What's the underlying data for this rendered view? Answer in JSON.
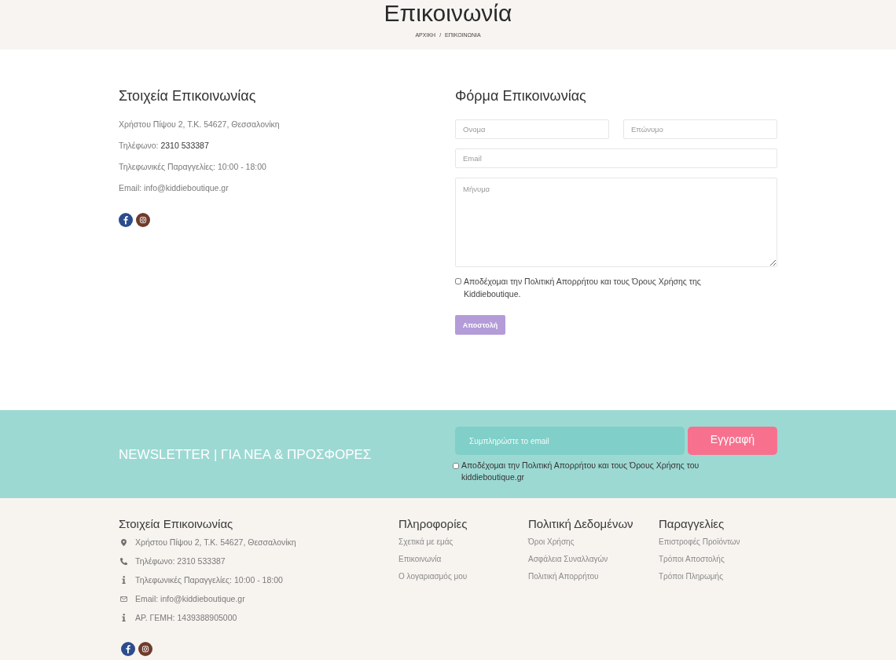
{
  "page_header": {
    "title": "Επικοινωνία",
    "breadcrumb": [
      {
        "label": "ΑΡΧΙΚΗ"
      },
      {
        "label": "ΕΠΙΚΟΙΝΩΝΙΑ"
      }
    ],
    "separator": "/"
  },
  "contact_info": {
    "heading": "Στοιχεία Επικοινωνίας",
    "lines": [
      {
        "text": "Χρήστου Πίψου 2, Τ.Κ. 54627, Θεσσαλονίκη"
      },
      {
        "text": "Τηλέφωνο:",
        "link": "2310 533387"
      },
      {
        "text": "Τηλεφωνικές Παραγγελίες: 10:00 - 18:00"
      },
      {
        "text": "Email: info@kiddieboutique.gr"
      }
    ],
    "socials": [
      {
        "kind": "facebook"
      },
      {
        "kind": "instagram"
      }
    ]
  },
  "contact_form": {
    "heading": "Φόρμα Επικοινωνίας",
    "rows": [
      [
        {
          "kind": "input",
          "placeholder": "Ονομα"
        },
        {
          "kind": "input",
          "placeholder": "Επώνυμο"
        }
      ],
      [
        {
          "kind": "input",
          "placeholder": "Email"
        }
      ],
      [
        {
          "kind": "textarea",
          "placeholder": "Μήνυμα"
        }
      ]
    ],
    "consent": {
      "checked": false,
      "label": "Αποδέχομαι την Πολιτική Απορρήτου και τους Όρους Χρήσης της Kiddieboutique."
    },
    "submit": "Αποστολή"
  },
  "newsletter": {
    "title": "NEWSLETTER | ΓΙΑ ΝΕΑ & ΠΡΟΣΦΟΡΕΣ",
    "placeholder": "Συμπληρώστε το email",
    "button": "Εγγραφή",
    "consent": {
      "checked": false,
      "label": "Αποδέχομαι την Πολιτική Απορρήτου και τους Όρους Χρήσης του kiddieboutique.gr"
    }
  },
  "footer": {
    "contact": {
      "heading": "Στοιχεία Επικοινωνίας",
      "items": [
        {
          "kind": "pin",
          "text": "Χρήστου Πίψου 2, Τ.Κ. 54627, Θεσσαλονίκη"
        },
        {
          "kind": "phone",
          "text": "Τηλέφωνο: 2310 533387"
        },
        {
          "kind": "info",
          "text": "Τηλεφωνικές Παραγγελίες: 10:00 - 18:00"
        },
        {
          "kind": "mail",
          "text": "Email: info@kiddieboutique.gr"
        },
        {
          "kind": "info",
          "text": "ΑΡ. ΓΕΜΗ: 1439388905000"
        }
      ],
      "socials": [
        {
          "kind": "facebook"
        },
        {
          "kind": "instagram"
        }
      ]
    },
    "columns": [
      {
        "heading": "Πληροφορίες",
        "links": [
          "Σχετικά με εμάς",
          "Επικοινωνία",
          "Ο λογαριασμός μου"
        ]
      },
      {
        "heading": "Πολιτική Δεδομένων",
        "links": [
          "Όροι Χρήσης",
          "Ασφάλεια Συναλλαγών",
          "Πολιτική Απορρήτου"
        ]
      },
      {
        "heading": "Παραγγελίες",
        "links": [
          "Επιστροφές Προϊόντων",
          "Τρόποι Αποστολής",
          "Τρόποι Πληρωμής"
        ]
      }
    ]
  }
}
